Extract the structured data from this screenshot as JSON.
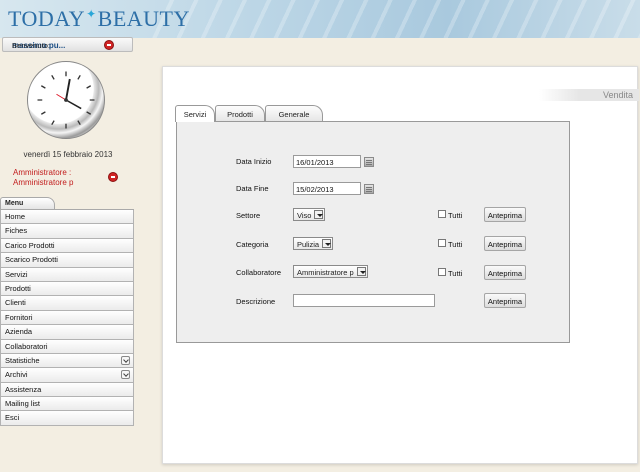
{
  "header": {
    "logo_left": "TODAY",
    "logo_right": "BEAUTY"
  },
  "welcome": {
    "label": "Benvenuto:",
    "user": "massimo pu..."
  },
  "sidebar": {
    "date": "venerdì 15 febbraio 2013",
    "admin_line1": "Amministratore :",
    "admin_line2": "Amministratore p",
    "menu_tab": "Menu",
    "items": [
      {
        "label": "Home"
      },
      {
        "label": "Fiches"
      },
      {
        "label": "Carico Prodotti"
      },
      {
        "label": "Scarico Prodotti"
      },
      {
        "label": "Servizi"
      },
      {
        "label": "Prodotti"
      },
      {
        "label": "Clienti"
      },
      {
        "label": "Fornitori"
      },
      {
        "label": "Azienda"
      },
      {
        "label": "Collaboratori"
      },
      {
        "label": "Statistiche"
      },
      {
        "label": "Archivi"
      },
      {
        "label": "Assistenza"
      },
      {
        "label": "Mailing list"
      },
      {
        "label": "Esci"
      }
    ]
  },
  "main": {
    "section_title": "Vendita",
    "tabs": [
      {
        "label": "Servizi"
      },
      {
        "label": "Prodotti"
      },
      {
        "label": "Generale"
      }
    ],
    "form": {
      "data_inizio_label": "Data Inizio",
      "data_inizio_value": "16/01/2013",
      "data_fine_label": "Data Fine",
      "data_fine_value": "15/02/2013",
      "settore_label": "Settore",
      "settore_value": "Viso",
      "categoria_label": "Categoria",
      "categoria_value": "Pulizia",
      "collaboratore_label": "Collaboratore",
      "collaboratore_value": "Amministratore p",
      "descrizione_label": "Descrizione",
      "descrizione_value": "",
      "tutti_label": "Tutti",
      "anteprima_label": "Anteprima"
    }
  },
  "colors": {
    "accent": "#2d6fa7",
    "admin_red": "#c21d1d",
    "user_blue": "#1c4f86"
  }
}
